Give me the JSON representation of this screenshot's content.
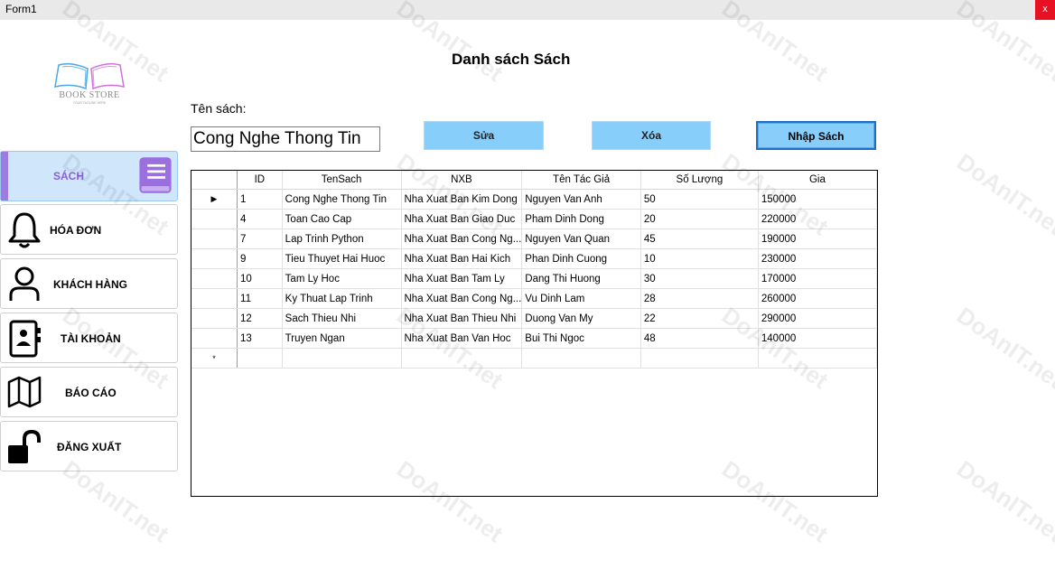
{
  "window": {
    "title": "Form1",
    "close_glyph": "x"
  },
  "logo": {
    "brand": "BOOK STORE",
    "tagline": "YOUR TAGLINE HERE",
    "icon": "open-book-logo"
  },
  "page": {
    "title": "Danh sách Sách"
  },
  "sidebar": {
    "items": [
      {
        "label": "SÁCH",
        "icon": "book-icon",
        "active": true
      },
      {
        "label": "HÓA ĐƠN",
        "icon": "bell-icon"
      },
      {
        "label": "KHÁCH HÀNG",
        "icon": "user-icon"
      },
      {
        "label": "TÀI KHOẢN",
        "icon": "contacts-book-icon"
      },
      {
        "label": "BÁO CÁO",
        "icon": "map-icon"
      },
      {
        "label": "ĐĂNG XUẤT",
        "icon": "unlock-icon"
      }
    ]
  },
  "form": {
    "name_label": "Tên sách:",
    "name_value": "Cong Nghe Thong Tin"
  },
  "buttons": {
    "edit": "Sửa",
    "delete": "Xóa",
    "import": "Nhập Sách"
  },
  "table": {
    "columns": [
      "ID",
      "TenSach",
      "NXB",
      "Tên Tác Giả",
      "Số Lượng",
      "Gia"
    ],
    "rows": [
      [
        "1",
        "Cong Nghe Thong Tin",
        "Nha Xuat Ban Kim Dong",
        "Nguyen Van Anh",
        "50",
        "150000"
      ],
      [
        "4",
        "Toan Cao Cap",
        "Nha Xuat Ban Giao Duc",
        "Pham Dinh Dong",
        "20",
        "220000"
      ],
      [
        "7",
        "Lap Trinh Python",
        "Nha Xuat Ban Cong Ng...",
        "Nguyen Van Quan",
        "45",
        "190000"
      ],
      [
        "9",
        "Tieu Thuyet Hai Huoc",
        "Nha Xuat Ban Hai Kich",
        "Phan Dinh Cuong",
        "10",
        "230000"
      ],
      [
        "10",
        "Tam Ly Hoc",
        "Nha Xuat Ban Tam Ly",
        "Dang Thi Huong",
        "30",
        "170000"
      ],
      [
        "11",
        "Ky Thuat Lap Trinh",
        "Nha Xuat Ban Cong Ng...",
        "Vu Dinh Lam",
        "28",
        "260000"
      ],
      [
        "12",
        "Sach Thieu Nhi",
        "Nha Xuat Ban Thieu Nhi",
        "Duong Van My",
        "22",
        "290000"
      ],
      [
        "13",
        "Truyen Ngan",
        "Nha Xuat Ban Van Hoc",
        "Bui Thi Ngoc",
        "48",
        "140000"
      ]
    ],
    "current_row_glyph": "▶",
    "new_row_glyph": "*"
  },
  "watermark": {
    "text": "DoAnIT.net"
  }
}
